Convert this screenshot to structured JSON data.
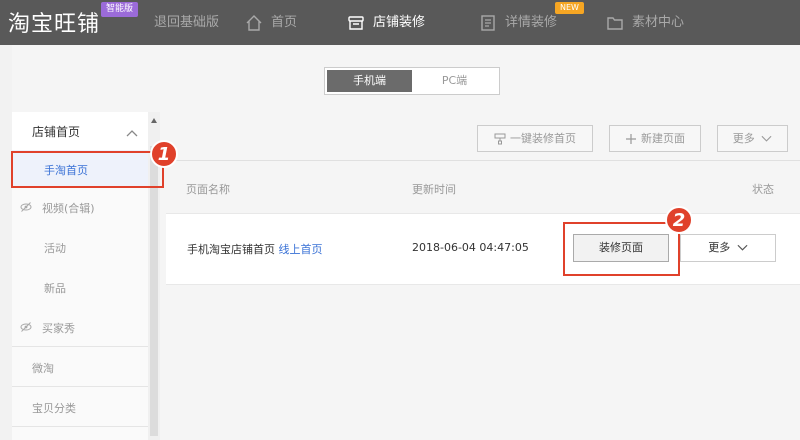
{
  "app": {
    "logo": "淘宝旺铺",
    "logo_badge": "智能版"
  },
  "nav": [
    {
      "label": "退回基础版"
    },
    {
      "label": "首页",
      "icon": "home-icon"
    },
    {
      "label": "店铺装修",
      "icon": "store-icon"
    },
    {
      "label": "详情装修",
      "icon": "document-icon",
      "badge": "NEW"
    },
    {
      "label": "素材中心",
      "icon": "folder-icon"
    }
  ],
  "device_tabs": [
    {
      "label": "手机端"
    },
    {
      "label": "PC端"
    }
  ],
  "sidebar": {
    "group": "店铺首页",
    "items": [
      {
        "label": "手淘首页"
      },
      {
        "label": "视频(合辑)",
        "icon": "hidden-eye-icon"
      },
      {
        "label": "活动"
      },
      {
        "label": "新品"
      },
      {
        "label": "买家秀",
        "icon": "hidden-eye-icon"
      },
      {
        "label": "微淘"
      },
      {
        "label": "宝贝分类"
      }
    ]
  },
  "toolbar": {
    "one_click": "一键装修首页",
    "new_page": "新建页面",
    "more": "更多"
  },
  "table": {
    "headers": {
      "name": "页面名称",
      "updated": "更新时间",
      "status": "状态"
    },
    "rows": [
      {
        "name": "手机淘宝店铺首页",
        "status_link": "线上首页",
        "updated": "2018-06-04 04:47:05",
        "action": "装修页面",
        "more": "更多"
      }
    ]
  },
  "annotations": {
    "step1": "1",
    "step2": "2"
  },
  "colors": {
    "topbar": "#595959",
    "accent_blue": "#3a72d6",
    "annotation_red": "#e0412b",
    "badge_purple": "#9b6bd9",
    "badge_orange": "#f6a623"
  }
}
